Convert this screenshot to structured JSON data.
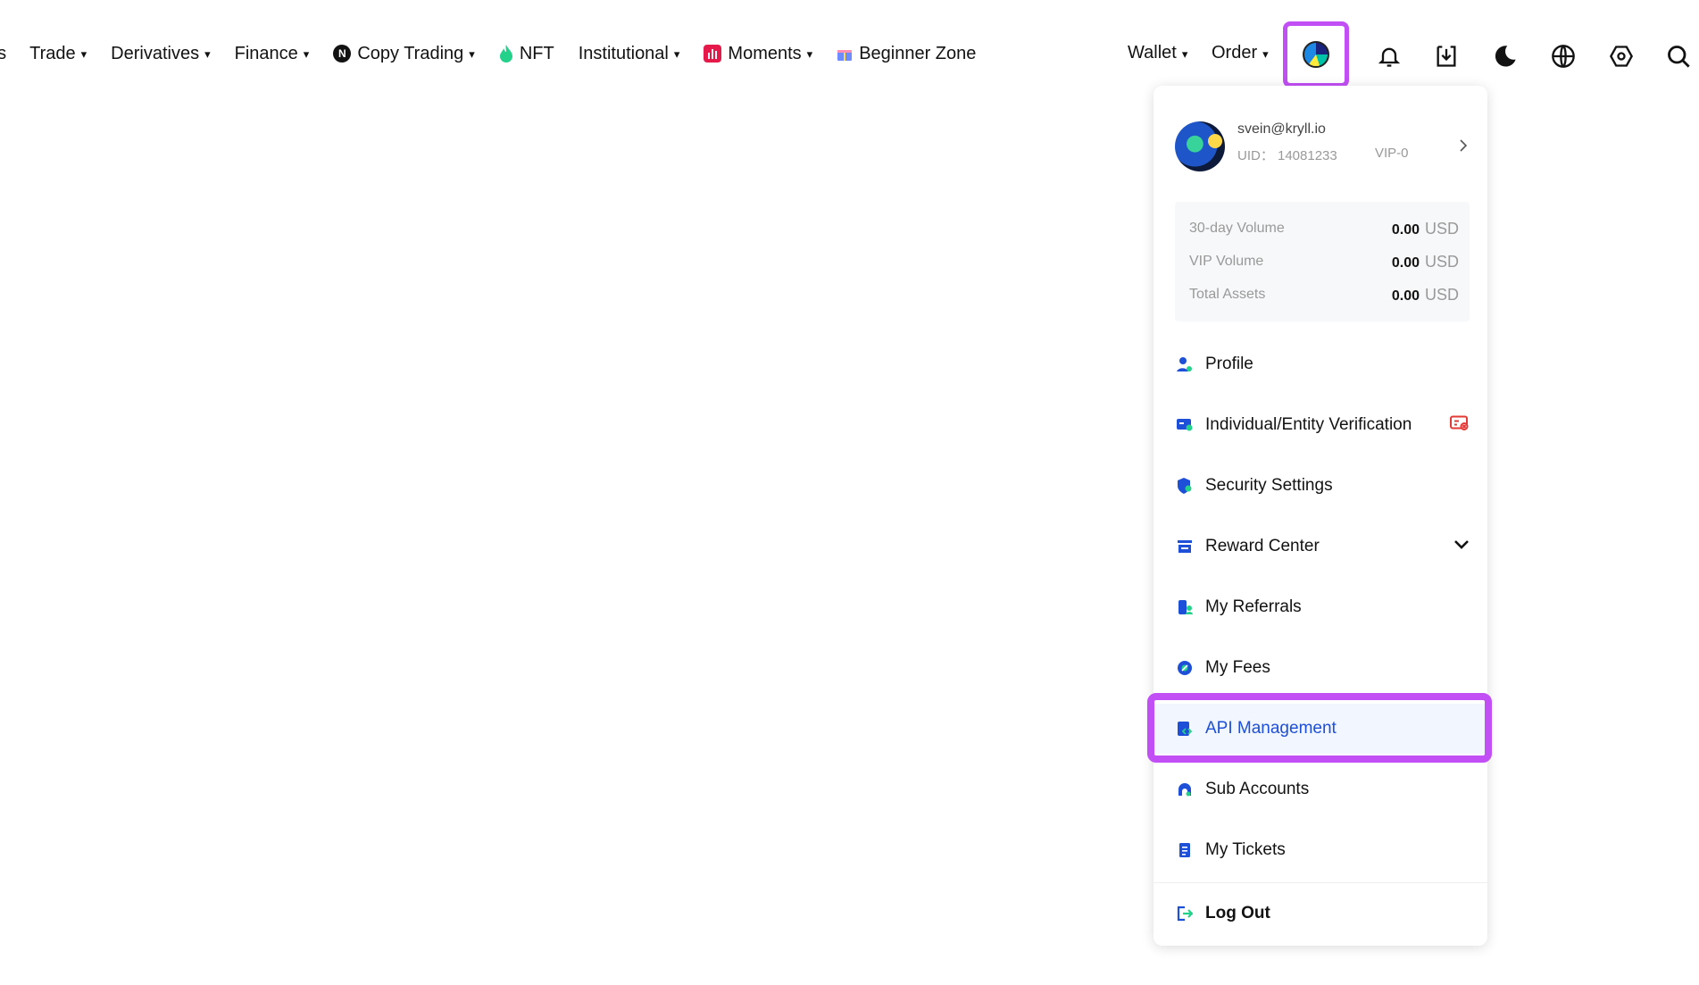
{
  "nav": {
    "left": [
      {
        "key": "cut",
        "label": "es",
        "caret": false
      },
      {
        "key": "trade",
        "label": "Trade",
        "caret": true
      },
      {
        "key": "derivatives",
        "label": "Derivatives",
        "caret": true
      },
      {
        "key": "finance",
        "label": "Finance",
        "caret": true
      },
      {
        "key": "copy-trading",
        "label": "Copy Trading",
        "caret": true,
        "badge": "N"
      },
      {
        "key": "nft",
        "label": "NFT",
        "caret": false
      },
      {
        "key": "institutional",
        "label": "Institutional",
        "caret": true
      },
      {
        "key": "moments",
        "label": "Moments",
        "caret": true
      },
      {
        "key": "beginner-zone",
        "label": "Beginner Zone",
        "caret": false
      }
    ],
    "caret_glyph": "▾",
    "wallet": "Wallet",
    "order": "Order",
    "icons": [
      "avatar-icon",
      "bell-icon",
      "download-icon",
      "moon-icon",
      "globe-icon",
      "settings-hex-icon",
      "search-icon"
    ],
    "colors": {
      "highlight": "#c24ef5",
      "nft_green": "#23d18b",
      "moments_red": "#e6194b"
    }
  },
  "user": {
    "email": "svein@kryll.io",
    "uid": "UID： 14081233",
    "vip": "VIP-0"
  },
  "stats": [
    {
      "label": "30-day Volume",
      "value": "0.00",
      "unit": "USD"
    },
    {
      "label": "VIP Volume",
      "value": "0.00",
      "unit": "USD"
    },
    {
      "label": "Total Assets",
      "value": "0.00",
      "unit": "USD"
    }
  ],
  "menu": [
    {
      "label": "Profile",
      "icon": "profile-icon"
    },
    {
      "label": "Individual/Entity Verification",
      "icon": "verification-icon",
      "badge": "unverified-badge-icon"
    },
    {
      "label": "Security Settings",
      "icon": "shield-icon"
    },
    {
      "label": "Reward Center",
      "icon": "reward-icon",
      "expand": true
    },
    {
      "label": "My Referrals",
      "icon": "referrals-icon"
    },
    {
      "label": "My Fees",
      "icon": "fees-icon"
    },
    {
      "label": "API Management",
      "icon": "api-icon",
      "active": true
    },
    {
      "label": "Sub Accounts",
      "icon": "sub-accounts-icon"
    },
    {
      "label": "My Tickets",
      "icon": "tickets-icon"
    }
  ],
  "logout": "Log Out"
}
